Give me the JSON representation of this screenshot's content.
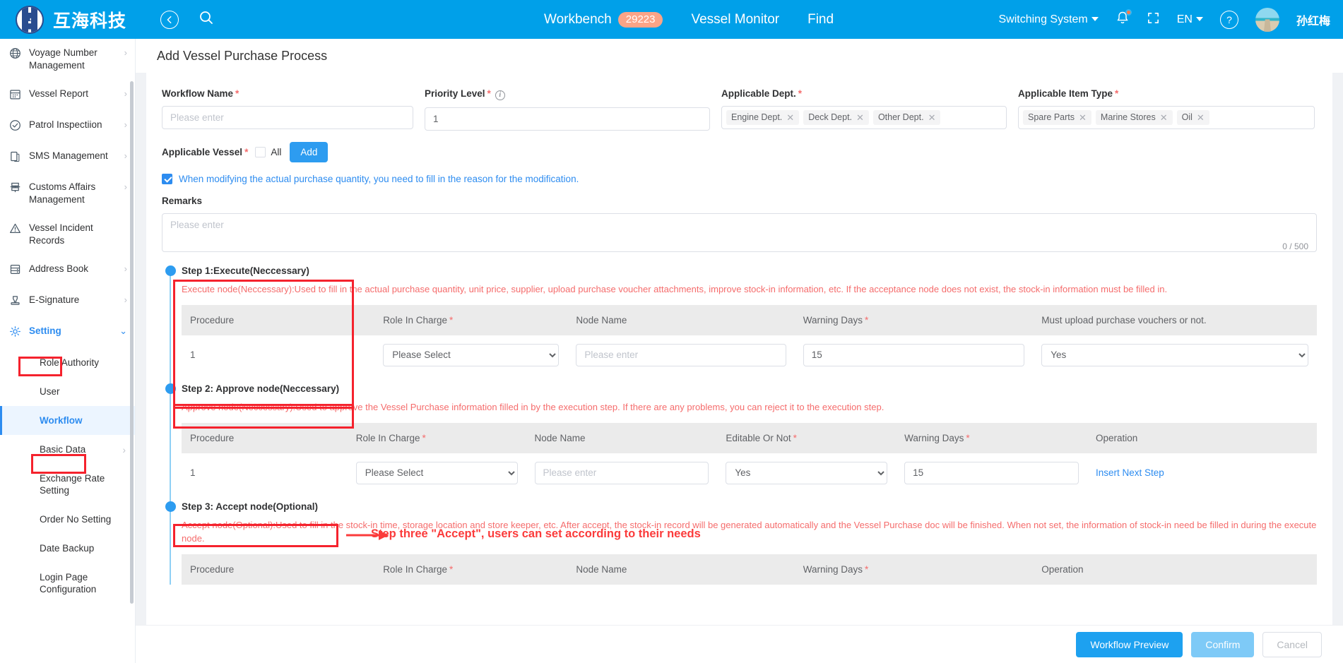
{
  "topbar": {
    "brand": "互海科技",
    "back_icon": "back-arrow-icon",
    "search_icon": "search-icon",
    "workbench_label": "Workbench",
    "workbench_count": "29223",
    "vessel_monitor_label": "Vessel Monitor",
    "find_label": "Find",
    "switching_system_label": "Switching System",
    "bell_icon": "notification-bell-icon",
    "fullscreen_icon": "fullscreen-icon",
    "language_label": "EN",
    "help_icon": "help-circle-icon",
    "user_name": "孙红梅",
    "accent_color": "#00a0e9",
    "badge_color": "#fba487"
  },
  "sidebar": {
    "items": [
      {
        "label": "Voyage Number Management",
        "icon": "globe-icon",
        "has_arrow": true
      },
      {
        "label": "Vessel Report",
        "icon": "calendar-icon",
        "has_arrow": true
      },
      {
        "label": "Patrol Inspectiion",
        "icon": "check-circle-icon",
        "has_arrow": true
      },
      {
        "label": "SMS Management",
        "icon": "documents-icon",
        "has_arrow": true
      },
      {
        "label": "Customs Affairs Management",
        "icon": "customs-icon",
        "has_arrow": true
      },
      {
        "label": "Vessel Incident Records",
        "icon": "warning-triangle-icon",
        "has_arrow": false
      },
      {
        "label": "Address Book",
        "icon": "address-book-icon",
        "has_arrow": true
      },
      {
        "label": "E-Signature",
        "icon": "stamp-icon",
        "has_arrow": true
      },
      {
        "label": "Setting",
        "icon": "gear-icon",
        "has_arrow": true,
        "expanded": true,
        "active": true
      }
    ],
    "sub_items": [
      {
        "label": "Role Authority",
        "has_arrow": false
      },
      {
        "label": "User",
        "has_arrow": false
      },
      {
        "label": "Workflow",
        "has_arrow": false,
        "active": true
      },
      {
        "label": "Basic Data",
        "has_arrow": true
      },
      {
        "label": "Exchange Rate Setting",
        "has_arrow": false
      },
      {
        "label": "Order No Setting",
        "has_arrow": false
      },
      {
        "label": "Date Backup",
        "has_arrow": false
      },
      {
        "label": "Login Page Configuration",
        "has_arrow": false
      }
    ]
  },
  "page": {
    "title": "Add Vessel Purchase Process"
  },
  "form": {
    "workflow_name": {
      "label": "Workflow Name",
      "required": true,
      "value": "",
      "placeholder": "Please enter"
    },
    "priority_level": {
      "label": "Priority Level",
      "required": true,
      "value": "1",
      "info_icon": "info-circle-icon"
    },
    "applicable_dept": {
      "label": "Applicable Dept.",
      "required": true,
      "tags": [
        "Engine Dept.",
        "Deck Dept.",
        "Other Dept."
      ]
    },
    "applicable_item_type": {
      "label": "Applicable Item Type",
      "required": true,
      "tags": [
        "Spare Parts",
        "Marine Stores",
        "Oil"
      ]
    },
    "applicable_vessel": {
      "label": "Applicable Vessel",
      "required": true,
      "all_label": "All",
      "all_checked": false,
      "add_label": "Add"
    },
    "modify_note": {
      "checked": true,
      "text": "When modifying the actual purchase quantity, you need to fill in the reason for the modification."
    },
    "remarks": {
      "label": "Remarks",
      "value": "",
      "placeholder": "Please enter",
      "counter": "0 / 500"
    }
  },
  "steps": [
    {
      "title": "Step 1:Execute(Neccessary)",
      "description": "Execute node(Neccessary):Used to fill in the actual purchase quantity, unit price, supplier, upload purchase voucher attachments, improve stock-in information, etc. If the acceptance node does not exist, the stock-in information must be filled in.",
      "columns": [
        "Procedure",
        "Role In Charge",
        "Node Name",
        "Warning Days",
        "Must upload purchase vouchers or not."
      ],
      "columns_required": [
        false,
        true,
        false,
        true,
        false
      ],
      "rows": [
        {
          "procedure": "1",
          "role_in_charge": "Please Select",
          "node_name": "",
          "node_name_placeholder": "Please enter",
          "warning_days": "15",
          "last_value": "Yes"
        }
      ]
    },
    {
      "title": "Step 2: Approve node(Neccessary)",
      "description": "Approve node(Neccessary):Used to approve the Vessel Purchase information filled in by the execution step. If there are any problems, you can reject it to the execution step.",
      "columns": [
        "Procedure",
        "Role In Charge",
        "Node Name",
        "Editable Or Not",
        "Warning Days",
        "Operation"
      ],
      "columns_required": [
        false,
        true,
        false,
        true,
        true,
        false
      ],
      "rows": [
        {
          "procedure": "1",
          "role_in_charge": "Please Select",
          "node_name": "",
          "node_name_placeholder": "Please enter",
          "editable": "Yes",
          "warning_days": "15",
          "operation": "Insert Next Step"
        }
      ]
    },
    {
      "title": "Step 3: Accept node(Optional)",
      "description": "Accept node(Optional):Used to fill in the stock-in time, storage location and store keeper, etc. After accept, the stock-in record will be generated automatically and the Vessel Purchase doc will be finished. When not set, the information of stock-in need be filled in during the execute node.",
      "columns": [
        "Procedure",
        "Role In Charge",
        "Node Name",
        "Warning Days",
        "Operation"
      ],
      "columns_required": [
        false,
        true,
        false,
        true,
        false
      ],
      "rows": []
    }
  ],
  "annotations": {
    "step3_note": "Step three \"Accept\", users can set according to their needs",
    "highlight_color": "#f5222d"
  },
  "footer": {
    "preview_label": "Workflow Preview",
    "confirm_label": "Confirm",
    "cancel_label": "Cancel"
  }
}
